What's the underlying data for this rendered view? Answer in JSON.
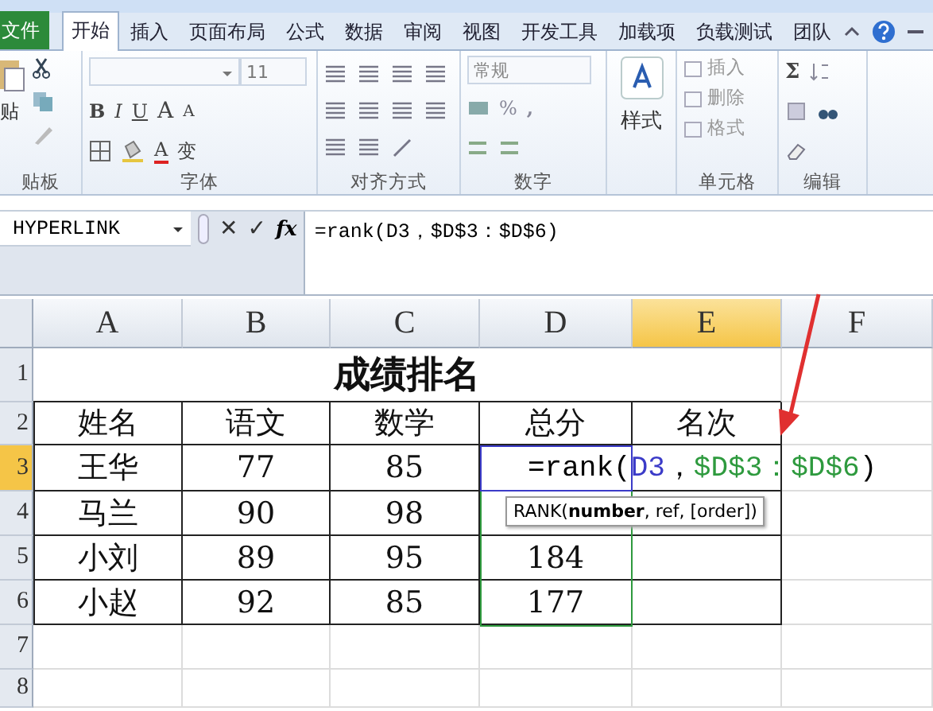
{
  "tabs": [
    {
      "label": "文件",
      "kind": "file",
      "selected": false
    },
    {
      "label": "开始",
      "kind": "tab",
      "selected": true
    },
    {
      "label": "插入",
      "kind": "tab",
      "selected": false
    },
    {
      "label": "页面布局",
      "kind": "tab",
      "selected": false
    },
    {
      "label": "公式",
      "kind": "tab",
      "selected": false
    },
    {
      "label": "数据",
      "kind": "tab",
      "selected": false
    },
    {
      "label": "审阅",
      "kind": "tab",
      "selected": false
    },
    {
      "label": "视图",
      "kind": "tab",
      "selected": false
    },
    {
      "label": "开发工具",
      "kind": "tab",
      "selected": false
    },
    {
      "label": "加载项",
      "kind": "tab",
      "selected": false
    },
    {
      "label": "负载测试",
      "kind": "tab",
      "selected": false
    },
    {
      "label": "团队",
      "kind": "tab",
      "selected": false
    }
  ],
  "ribbon": {
    "clipboard": {
      "label": "贴板",
      "paste": "贴"
    },
    "font": {
      "label": "字体",
      "size": "11",
      "styles": [
        "B",
        "I",
        "U"
      ],
      "grow": "A",
      "shrink": "A",
      "font_color_button": "A",
      "phonetic": "变"
    },
    "alignment": {
      "label": "对齐方式"
    },
    "number": {
      "label": "数字",
      "format": "常规",
      "percent": "%",
      "comma": ","
    },
    "styles": {
      "button": "样式"
    },
    "cells": {
      "label": "单元格",
      "buttons": [
        "插入",
        "删除",
        "格式"
      ]
    },
    "editing": {
      "label": "编辑",
      "sum": "Σ"
    }
  },
  "formula_bar": {
    "name_box": "HYPERLINK",
    "cancel": "✕",
    "enter": "✓",
    "function": "fx",
    "formula": "=rank(D3，$D$3：$D$6)"
  },
  "sheet": {
    "columns": [
      {
        "label": "A",
        "selected": false
      },
      {
        "label": "B",
        "selected": false
      },
      {
        "label": "C",
        "selected": false
      },
      {
        "label": "D",
        "selected": false
      },
      {
        "label": "E",
        "selected": true
      },
      {
        "label": "F",
        "selected": false
      }
    ],
    "rows": [
      {
        "label": "1",
        "selected": false
      },
      {
        "label": "2",
        "selected": false
      },
      {
        "label": "3",
        "selected": true
      },
      {
        "label": "4",
        "selected": false
      },
      {
        "label": "5",
        "selected": false
      },
      {
        "label": "6",
        "selected": false
      },
      {
        "label": "7",
        "selected": false
      },
      {
        "label": "8",
        "selected": false
      }
    ],
    "table": {
      "title": "成绩排名",
      "header": [
        "姓名",
        "语文",
        "数学",
        "总分",
        "名次"
      ],
      "rows": [
        {
          "cells": [
            "王华",
            "77",
            "85"
          ],
          "editing": [
            {
              "text": "=rank(",
              "color": "#000000"
            },
            {
              "text": "D3",
              "color": "#3b3bc8"
            },
            {
              "text": "，",
              "color": "#000000"
            },
            {
              "text": "$D$3：$D$6",
              "color": "#2e9a3e"
            },
            {
              "text": ")",
              "color": "#000000"
            }
          ]
        },
        {
          "cells": [
            "马兰",
            "90",
            "98"
          ]
        },
        {
          "cells": [
            "小刘",
            "89",
            "95",
            "184"
          ]
        },
        {
          "cells": [
            "小赵",
            "92",
            "85",
            "177"
          ]
        }
      ]
    },
    "tooltip": "RANK(**number**, ref, [order])"
  }
}
